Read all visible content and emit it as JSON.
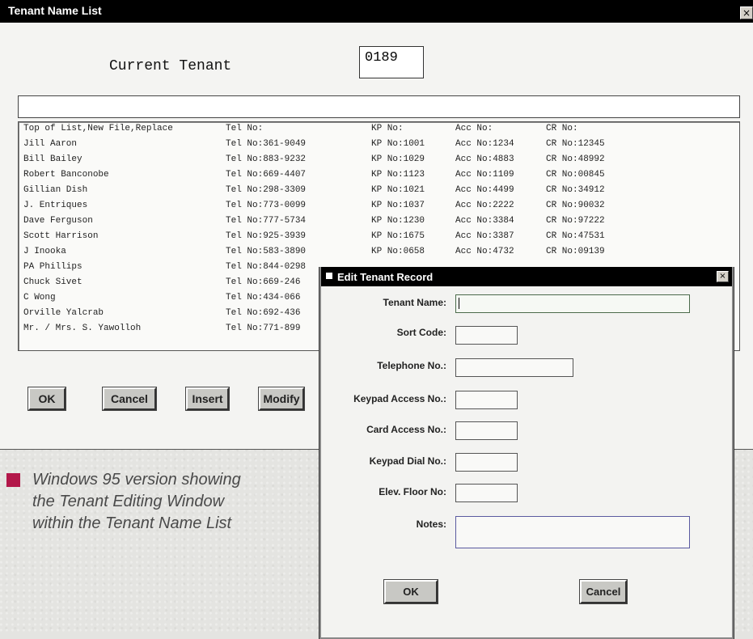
{
  "window": {
    "title": "Tenant Name List",
    "close_glyph": "×"
  },
  "current_tenant": {
    "label": "Current Tenant",
    "value": "0189"
  },
  "list": {
    "rows": [
      {
        "name": "Top of List,New File,Replace",
        "tel": "Tel No:",
        "kp": "KP No:",
        "acc": "Acc No:",
        "cr": "CR No:"
      },
      {
        "name": "Jill Aaron",
        "tel": "Tel No:361-9049",
        "kp": "KP No:1001",
        "acc": "Acc No:1234",
        "cr": "CR No:12345"
      },
      {
        "name": "Bill Bailey",
        "tel": "Tel No:883-9232",
        "kp": "KP No:1029",
        "acc": "Acc No:4883",
        "cr": "CR No:48992"
      },
      {
        "name": "Robert Banconobe",
        "tel": "Tel No:669-4407",
        "kp": "KP No:1123",
        "acc": "Acc No:1109",
        "cr": "CR No:00845"
      },
      {
        "name": "Gillian Dish",
        "tel": "Tel No:298-3309",
        "kp": "KP No:1021",
        "acc": "Acc No:4499",
        "cr": "CR No:34912"
      },
      {
        "name": "J. Entriques",
        "tel": "Tel No:773-0099",
        "kp": "KP No:1037",
        "acc": "Acc No:2222",
        "cr": "CR No:90032"
      },
      {
        "name": "Dave Ferguson",
        "tel": "Tel No:777-5734",
        "kp": "KP No:1230",
        "acc": "Acc No:3384",
        "cr": "CR No:97222"
      },
      {
        "name": "Scott Harrison",
        "tel": "Tel No:925-3939",
        "kp": "KP No:1675",
        "acc": "Acc No:3387",
        "cr": "CR No:47531"
      },
      {
        "name": "J Inooka",
        "tel": "Tel No:583-3890",
        "kp": "KP No:0658",
        "acc": "Acc No:4732",
        "cr": "CR No:09139"
      },
      {
        "name": "PA Phillips",
        "tel": "Tel No:844-0298",
        "kp": "",
        "acc": "",
        "cr": ""
      },
      {
        "name": "Chuck Sivet",
        "tel": "Tel No:669-246",
        "kp": "",
        "acc": "",
        "cr": ""
      },
      {
        "name": "C Wong",
        "tel": "Tel No:434-066",
        "kp": "",
        "acc": "",
        "cr": ""
      },
      {
        "name": "Orville Yalcrab",
        "tel": "Tel No:692-436",
        "kp": "",
        "acc": "",
        "cr": ""
      },
      {
        "name": "Mr. / Mrs. S. Yawolloh",
        "tel": "Tel No:771-899",
        "kp": "",
        "acc": "",
        "cr": ""
      }
    ]
  },
  "buttons": {
    "ok": "OK",
    "cancel": "Cancel",
    "insert": "Insert",
    "modify": "Modify"
  },
  "caption": {
    "text": "Windows 95 version showing the Tenant Editing Window within the Tenant Name List",
    "accent_color": "#b3184a"
  },
  "dialog": {
    "title": "Edit Tenant Record",
    "close_glyph": "×",
    "fields": {
      "tenant_name": "Tenant Name:",
      "sort_code": "Sort Code:",
      "telephone": "Telephone No.:",
      "keypad_access": "Keypad Access No.:",
      "card_access": "Card Access No.:",
      "keypad_dial": "Keypad Dial No.:",
      "elev_floor": "Elev. Floor No:",
      "notes": "Notes:"
    },
    "ok": "OK",
    "cancel": "Cancel"
  }
}
